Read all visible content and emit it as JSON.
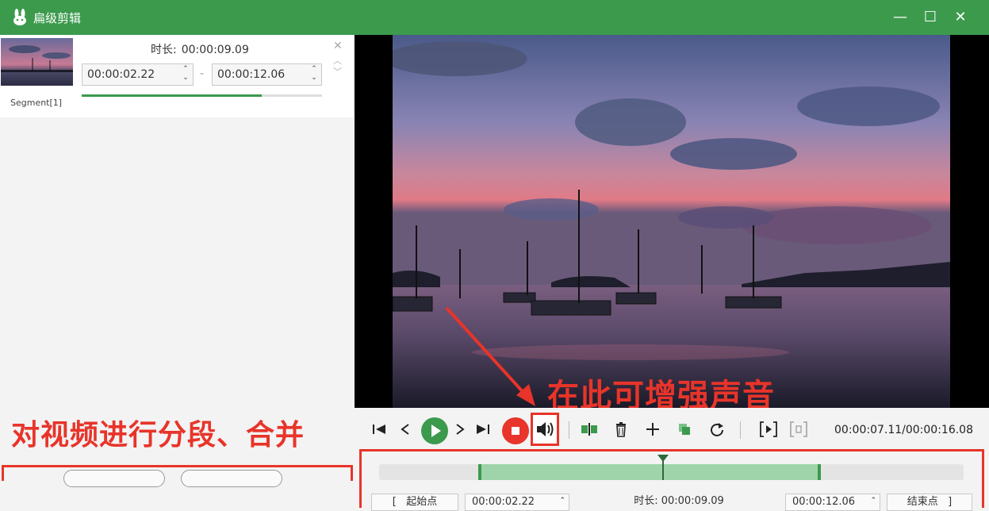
{
  "app": {
    "title": "扁级剪辑",
    "logo_icon": "rabbit-icon"
  },
  "window_controls": {
    "minimize": "—",
    "maximize": "☐",
    "close": "✕"
  },
  "segment": {
    "name": "Segment[1]",
    "duration_label": "时长:",
    "duration_value": "00:00:09.09",
    "start_time": "00:00:02.22",
    "end_time": "00:00:12.06",
    "separator": "-",
    "progress": 0.75
  },
  "annotations": {
    "left": "对视频进行分段、合并",
    "right": "在此可增强声音",
    "accent_color": "#e8342a"
  },
  "player": {
    "time_readout": "00:00:07.11/00:00:16.08",
    "playhead_fraction": 0.4
  },
  "timeline": {
    "start_label": "起始点",
    "start_value": "00:00:02.22",
    "duration_label": "时长:",
    "duration_value": "00:00:09.09",
    "end_value": "00:00:12.06",
    "end_label": "结束点"
  },
  "colors": {
    "brand": "#3c9a4d",
    "stop": "#e8342a"
  }
}
